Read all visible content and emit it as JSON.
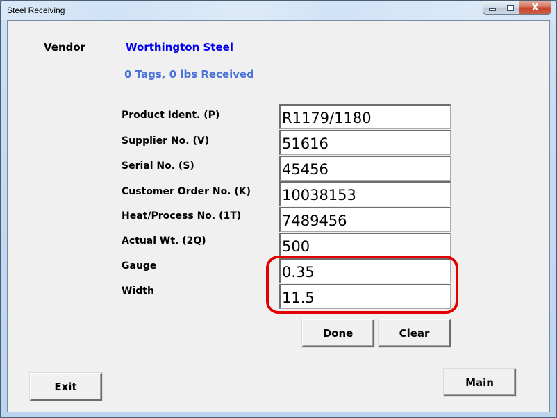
{
  "window": {
    "title": "Steel Receiving",
    "caption_buttons": {
      "minimize_icon": "window-minimize-icon",
      "maximize_icon": "window-maximize-icon",
      "close_icon": "window-close-icon",
      "close_glyph": "X"
    }
  },
  "header": {
    "vendor_label": "Vendor",
    "vendor_value": "Worthington Steel",
    "received_summary": "0 Tags, 0 lbs Received"
  },
  "form": {
    "fields": [
      {
        "label": "Product Ident. (P)",
        "value": "R1179/1180"
      },
      {
        "label": "Supplier No. (V)",
        "value": "51616"
      },
      {
        "label": "Serial No. (S)",
        "value": "45456"
      },
      {
        "label": "Customer Order No. (K)",
        "value": "10038153"
      },
      {
        "label": "Heat/Process No. (1T)",
        "value": "7489456"
      },
      {
        "label": "Actual Wt. (2Q)",
        "value": "500"
      },
      {
        "label": "Gauge",
        "value": "0.35"
      },
      {
        "label": "Width",
        "value": "11.5"
      }
    ]
  },
  "buttons": {
    "done": "Done",
    "clear": "Clear",
    "exit": "Exit",
    "main": "Main"
  },
  "annotation": {
    "color": "#e30000",
    "highlights": [
      "Gauge",
      "Width"
    ]
  }
}
